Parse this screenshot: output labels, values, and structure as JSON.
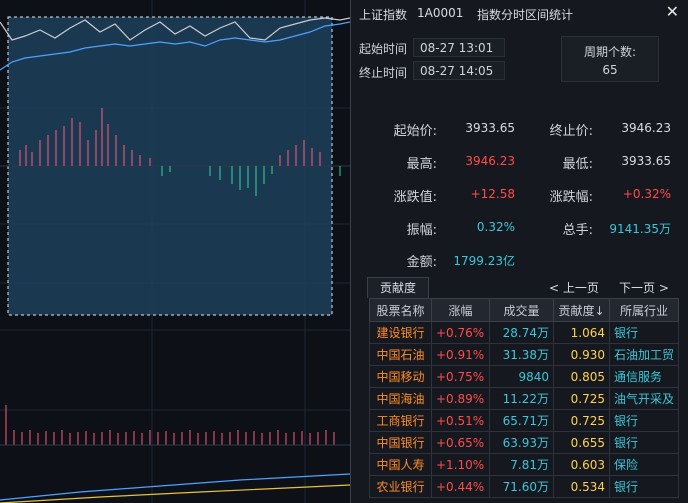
{
  "header": {
    "index_name": "上证指数",
    "index_code": "1A0001",
    "window_title": "指数分时区间统计",
    "close_symbol": "✕"
  },
  "time_range": {
    "start_label": "起始时间",
    "start_value": "08-27 13:01",
    "end_label": "终止时间",
    "end_value": "08-27 14:05",
    "cycle_label": "周期个数:",
    "cycle_value": "65"
  },
  "stats": {
    "start_price_label": "起始价:",
    "start_price": "3933.65",
    "end_price_label": "终止价:",
    "end_price": "3946.23",
    "high_label": "最高:",
    "high": "3946.23",
    "low_label": "最低:",
    "low": "3933.65",
    "change_label": "涨跌值:",
    "change": "+12.58",
    "change_pct_label": "涨跌幅:",
    "change_pct": "+0.32%",
    "amplitude_label": "振幅:",
    "amplitude": "0.32%",
    "total_volume_label": "总手:",
    "total_volume": "9141.35万",
    "amount_label": "金额:",
    "amount": "1799.23亿"
  },
  "contribution": {
    "tab_label": "贡献度",
    "prev_page": "< 上一页",
    "next_page": "下一页 >",
    "columns": [
      "股票名称",
      "涨幅",
      "成交量",
      "贡献度↓",
      "所属行业"
    ],
    "rows": [
      {
        "name": "建设银行",
        "chg": "+0.76%",
        "vol": "28.74万",
        "contrib": "1.064",
        "industry": "银行"
      },
      {
        "name": "中国石油",
        "chg": "+0.91%",
        "vol": "31.38万",
        "contrib": "0.930",
        "industry": "石油加工贸"
      },
      {
        "name": "中国移动",
        "chg": "+0.75%",
        "vol": "9840",
        "contrib": "0.805",
        "industry": "通信服务"
      },
      {
        "name": "中国海油",
        "chg": "+0.89%",
        "vol": "11.22万",
        "contrib": "0.725",
        "industry": "油气开采及"
      },
      {
        "name": "工商银行",
        "chg": "+0.51%",
        "vol": "65.71万",
        "contrib": "0.725",
        "industry": "银行"
      },
      {
        "name": "中国银行",
        "chg": "+0.65%",
        "vol": "63.93万",
        "contrib": "0.655",
        "industry": "银行"
      },
      {
        "name": "中国人寿",
        "chg": "+1.10%",
        "vol": "7.81万",
        "contrib": "0.603",
        "industry": "保险"
      },
      {
        "name": "农业银行",
        "chg": "+0.44%",
        "vol": "71.60万",
        "contrib": "0.534",
        "industry": "银行"
      }
    ]
  },
  "colors": {
    "rise": "#ff4b4b",
    "neutral": "#3bc7d9",
    "stock_name": "#ff8c2b",
    "contribution": "#ffd34d",
    "selection_fill": "#1e3f5c"
  }
}
